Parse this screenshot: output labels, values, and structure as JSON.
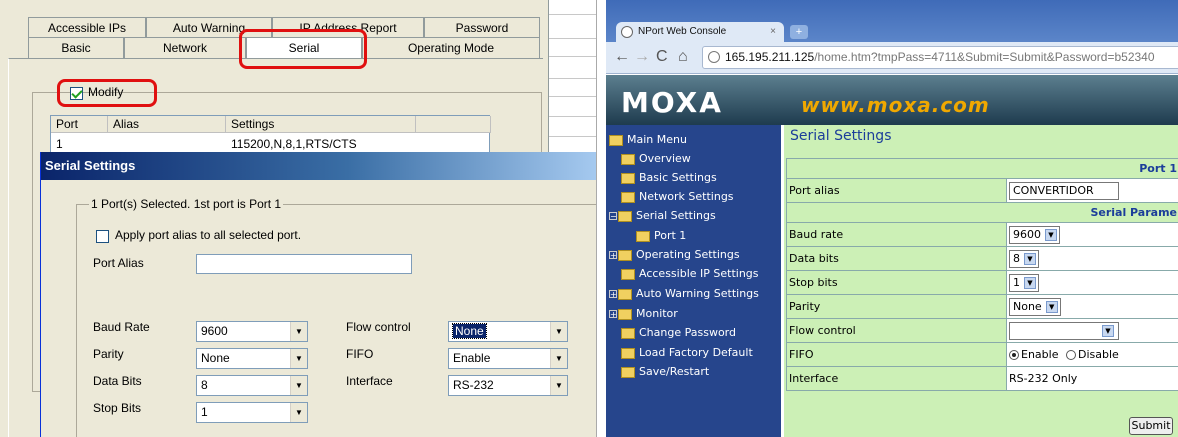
{
  "left": {
    "tabs_row1": [
      "Accessible IPs",
      "Auto Warning",
      "IP Address Report",
      "Password"
    ],
    "tabs_row2": [
      "Basic",
      "Network",
      "Serial",
      "Operating Mode"
    ],
    "modify_label": "Modify",
    "table": {
      "headers": [
        "Port",
        "Alias",
        "Settings"
      ],
      "row": [
        "1",
        "",
        "115200,N,8,1,RTS/CTS"
      ]
    },
    "dialog": {
      "title": "Serial Settings",
      "group_label": "1 Port(s) Selected. 1st port is Port 1",
      "apply_alias_label": "Apply port alias to all selected port.",
      "port_alias_label": "Port Alias",
      "port_alias_value": "",
      "fields": {
        "baud_rate": {
          "label": "Baud Rate",
          "value": "9600"
        },
        "parity": {
          "label": "Parity",
          "value": "None"
        },
        "data_bits": {
          "label": "Data Bits",
          "value": "8"
        },
        "stop_bits": {
          "label": "Stop Bits",
          "value": "1"
        },
        "flow_control": {
          "label": "Flow control",
          "value": "None"
        },
        "fifo": {
          "label": "FIFO",
          "value": "Enable"
        },
        "interface": {
          "label": "Interface",
          "value": "RS-232"
        }
      }
    }
  },
  "browser": {
    "tab_title": "NPort Web Console",
    "new_tab": "+",
    "url_host": "165.195.211.125",
    "url_path": "/home.htm?tmpPass=4711&Submit=Submit&Password=b52340",
    "banner": {
      "logo": "MOXA",
      "site": "www.moxa.com"
    },
    "nav": [
      {
        "label": "Main Menu"
      },
      {
        "label": "Overview"
      },
      {
        "label": "Basic Settings"
      },
      {
        "label": "Network Settings"
      },
      {
        "label": "Serial Settings"
      },
      {
        "label": "Port 1"
      },
      {
        "label": "Operating Settings"
      },
      {
        "label": "Accessible IP Settings"
      },
      {
        "label": "Auto Warning Settings"
      },
      {
        "label": "Monitor"
      },
      {
        "label": "Change Password"
      },
      {
        "label": "Load Factory Default"
      },
      {
        "label": "Save/Restart"
      }
    ],
    "content_title": "Serial Settings",
    "port_header": "Port 1",
    "serial_params_header": "Serial Parame",
    "rows": {
      "port_alias": {
        "label": "Port alias",
        "value": "CONVERTIDOR"
      },
      "baud_rate": {
        "label": "Baud rate",
        "value": "9600"
      },
      "data_bits": {
        "label": "Data bits",
        "value": "8"
      },
      "stop_bits": {
        "label": "Stop bits",
        "value": "1"
      },
      "parity": {
        "label": "Parity",
        "value": "None"
      },
      "flow_control": {
        "label": "Flow control",
        "value": ""
      },
      "fifo": {
        "label": "FIFO",
        "opt_enable": "Enable",
        "opt_disable": "Disable",
        "selected": "Enable"
      },
      "interface": {
        "label": "Interface",
        "value": "RS-232 Only"
      }
    },
    "submit_label": "Submit"
  },
  "colors": {
    "highlight_red": "#e01010",
    "moxa_orange": "#f0a800",
    "nav_blue": "#26458c",
    "content_green": "#ccf0b6"
  }
}
